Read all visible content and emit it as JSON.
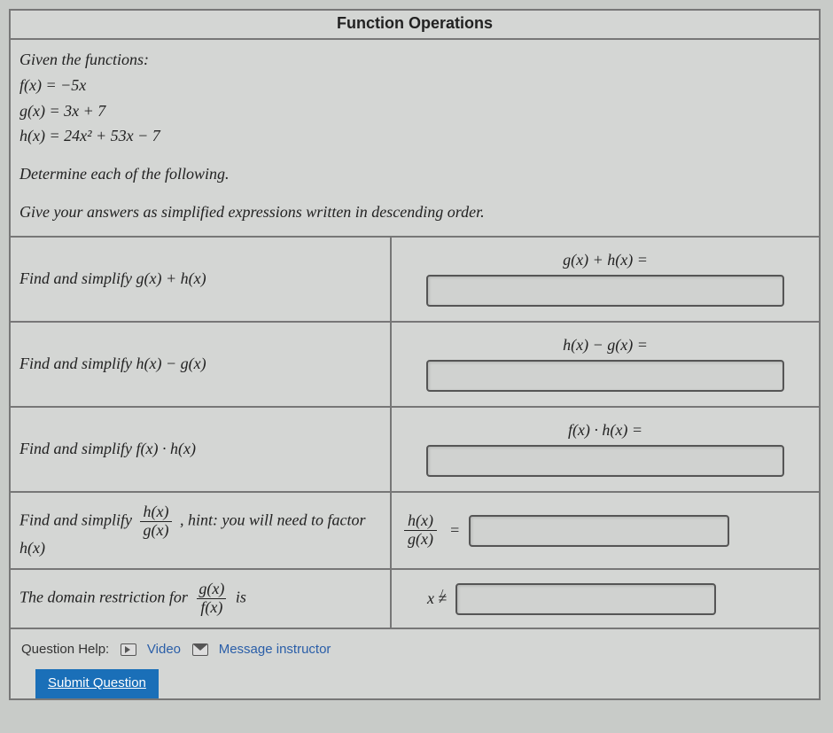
{
  "title": "Function Operations",
  "given_label": "Given the functions:",
  "functions": {
    "f": "f(x) = −5x",
    "g": "g(x) = 3x + 7",
    "h": "h(x) = 24x² + 53x − 7"
  },
  "instr1": "Determine each of the following.",
  "instr2": "Give your answers as simplified expressions written in descending order.",
  "rows": [
    {
      "prompt_pre": "Find and simplify ",
      "prompt_expr": "g(x) + h(x)",
      "answer_label": "g(x) + h(x) ="
    },
    {
      "prompt_pre": "Find and simplify ",
      "prompt_expr": "h(x) − g(x)",
      "answer_label": "h(x) − g(x) ="
    },
    {
      "prompt_pre": "Find and simplify ",
      "prompt_expr": "f(x) · h(x)",
      "answer_label": "f(x) · h(x) ="
    },
    {
      "prompt_pre": "Find and simplify ",
      "frac_num": "h(x)",
      "frac_den": "g(x)",
      "prompt_post": ", hint: you will need to factor h(x)",
      "ans_frac_num": "h(x)",
      "ans_frac_den": "g(x)",
      "eq": "="
    },
    {
      "prompt_pre": "The domain restriction for ",
      "frac_num": "g(x)",
      "frac_den": "f(x)",
      "prompt_post": " is",
      "ans_pre": "x ≠"
    }
  ],
  "help": {
    "label": "Question Help:",
    "video": "Video",
    "message": "Message instructor"
  },
  "submit": "Submit Question"
}
